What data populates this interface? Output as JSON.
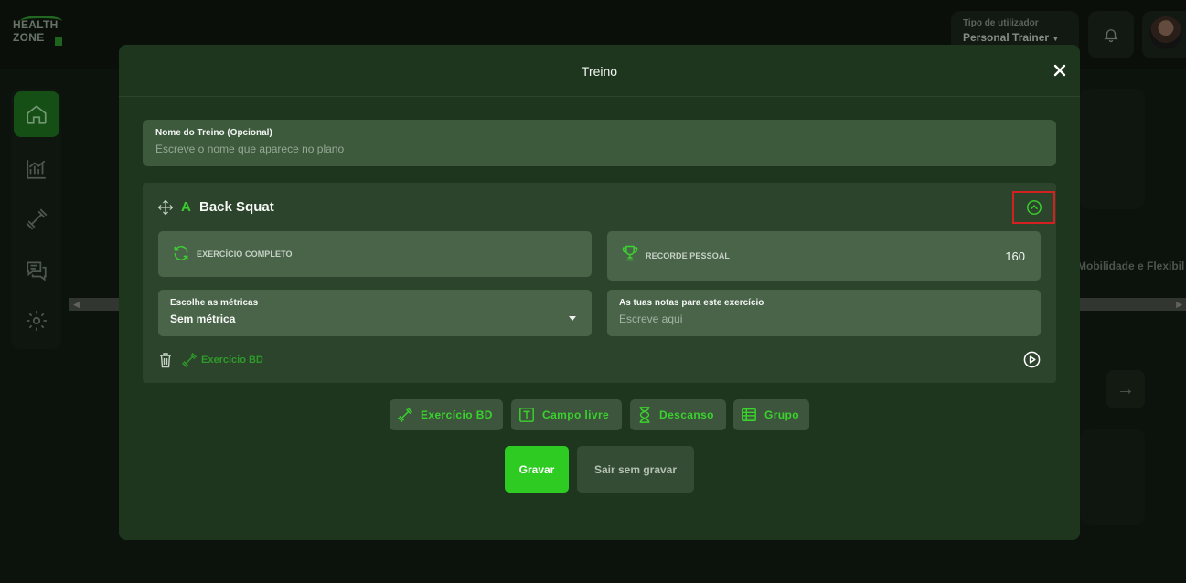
{
  "app": {
    "logo_line1": "HEALTH",
    "logo_line2": "ZONE"
  },
  "header": {
    "user_type_label": "Tipo de utilizador",
    "user_type_value": "Personal Trainer"
  },
  "background": {
    "partial_text": "Mobilidade e Flexibil"
  },
  "modal": {
    "title": "Treino",
    "name_field": {
      "label": "Nome do Treino (Opcional)",
      "placeholder": "Escreve o nome que aparece no plano",
      "value": ""
    },
    "exercise": {
      "letter": "A",
      "name": "Back Squat",
      "complete_label": "EXERCÍCIO COMPLETO",
      "record_label": "RECORDE PESSOAL",
      "record_value": "160",
      "metrics_label": "Escolhe as métricas",
      "metrics_value": "Sem métrica",
      "notes_label": "As tuas notas para este exercício",
      "notes_placeholder": "Escreve aqui",
      "bd_link": "Exercício BD"
    },
    "add_buttons": {
      "exercise_bd": "Exercício BD",
      "free_field": "Campo livre",
      "rest": "Descanso",
      "group": "Grupo"
    },
    "save": "Gravar",
    "exit": "Sair sem gravar"
  },
  "colors": {
    "accent": "#2ecc22",
    "modal_bg": "#1e351e",
    "card_bg": "#2c432c",
    "highlight_border": "#d42020"
  },
  "icons": [
    "home-icon",
    "chart-icon",
    "dumbbell-icon",
    "chat-icon",
    "gear-icon",
    "bell-icon",
    "close-icon",
    "move-icon",
    "chevron-up-icon",
    "refresh-icon",
    "trophy-icon",
    "chevron-down-icon",
    "trash-icon",
    "play-icon",
    "text-icon",
    "hourglass-icon",
    "table-icon"
  ]
}
